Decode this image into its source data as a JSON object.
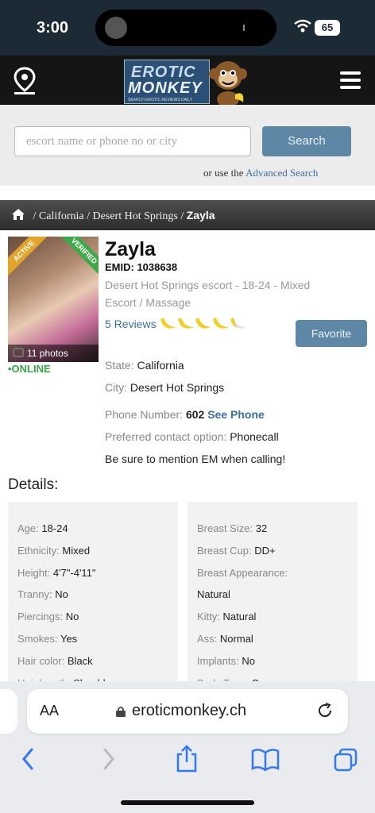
{
  "status_bar": {
    "time": "3:00",
    "battery": "65",
    "wifi_icon": "wifi-icon"
  },
  "header": {
    "logo_line1": "EROTIC",
    "logo_line2": "MONKEY",
    "logo_tagline": "SEARCH EROTIC REVIEWS DAILY",
    "location_icon": "location-pin-icon",
    "menu_icon": "hamburger-menu-icon"
  },
  "search": {
    "placeholder": "escort name or phone no or city",
    "button": "Search",
    "adv_prefix": "or use the",
    "adv_link": "Advanced Search"
  },
  "breadcrumb": {
    "home_icon": "home-icon",
    "items": [
      " / California",
      " / Desert Hot Springs",
      " / "
    ],
    "current": "Zayla"
  },
  "profile": {
    "photo_count": "11 photos",
    "ribbon_active": "ACTIVE",
    "ribbon_verified": "VERIFIED",
    "online": "•ONLINE",
    "name": "Zayla",
    "emid": "EMID: 1038638",
    "description": "Desert Hot Springs escort - 18-24 - Mixed Escort / Massage",
    "reviews": "5 Reviews",
    "rating": {
      "value": 4.5,
      "max": 5,
      "icon": "banana-icon"
    },
    "favorite_button": "Favorite",
    "state_label": "State:",
    "state": "California",
    "city_label": "City:",
    "city": "Desert Hot Springs",
    "phone_label": "Phone Number:",
    "phone_partial": "602",
    "see_phone": "See Phone",
    "contact_label": "Preferred contact option:",
    "contact": "Phonecall",
    "mention": "Be sure to mention EM when calling!"
  },
  "details": {
    "heading": "Details:",
    "left": [
      {
        "k": "Age:",
        "v": "18-24"
      },
      {
        "k": "Ethnicity:",
        "v": "Mixed"
      },
      {
        "k": "Height:",
        "v": "4'7\"-4'11\""
      },
      {
        "k": "Tranny:",
        "v": "No"
      },
      {
        "k": "Piercings:",
        "v": "No"
      },
      {
        "k": "Smokes:",
        "v": "Yes"
      },
      {
        "k": "Hair color:",
        "v": "Black"
      },
      {
        "k": "Hair length:",
        "v": "Shoulder"
      }
    ],
    "right": [
      {
        "k": "Breast Size:",
        "v": "32"
      },
      {
        "k": "Breast Cup:",
        "v": "DD+"
      },
      {
        "k": "Breast Appearance:",
        "v": ""
      },
      {
        "k": "",
        "v": "Natural"
      },
      {
        "k": "Kitty:",
        "v": "Natural"
      },
      {
        "k": "Ass:",
        "v": "Normal"
      },
      {
        "k": "Implants:",
        "v": "No"
      },
      {
        "k": "Body Type:",
        "v": "Curvy"
      }
    ]
  },
  "browser": {
    "aa": "AA",
    "url": "eroticmonkey.ch",
    "toolbar": [
      "back-icon",
      "forward-icon",
      "share-icon",
      "bookmarks-icon",
      "tabs-icon"
    ]
  },
  "colors": {
    "accent": "#3d6e9c",
    "button": "#5e87a6",
    "online": "#3aa34a",
    "header": "#151515"
  }
}
